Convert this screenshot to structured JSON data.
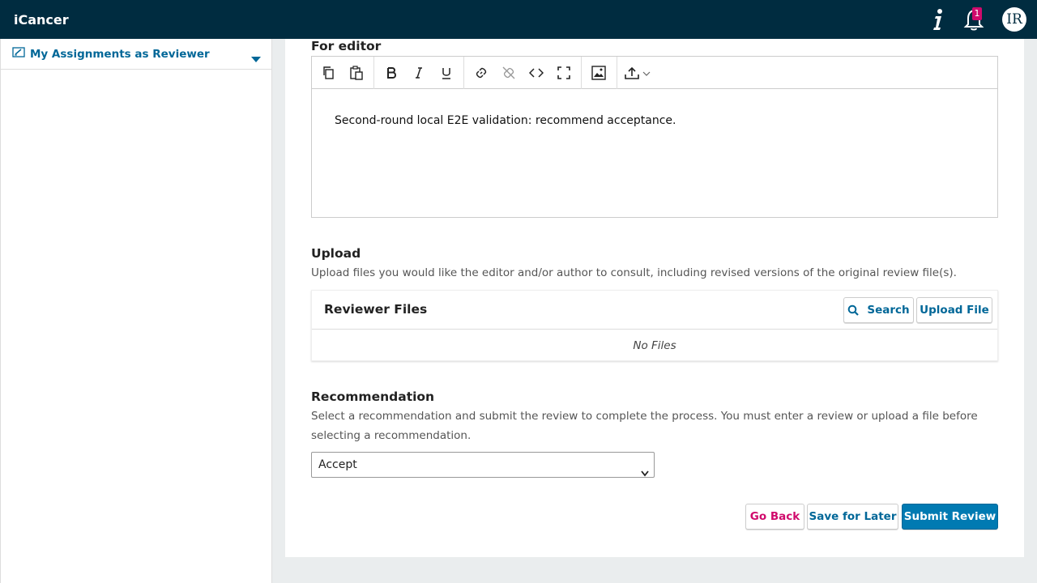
{
  "app": {
    "title": "iCancer"
  },
  "header": {
    "notification_count": "1",
    "avatar_initials": "IR"
  },
  "sidebar": {
    "items": [
      {
        "label": "My Assignments as Reviewer"
      }
    ]
  },
  "review": {
    "for_editor_label": "For editor",
    "editor_text": "Second-round local E2E validation: recommend acceptance.",
    "upload_label": "Upload",
    "upload_desc": "Upload files you would like the editor and/or author to consult, including revised versions of the original review file(s).",
    "files_title": "Reviewer Files",
    "search_label": "Search",
    "upload_file_label": "Upload File",
    "no_files": "No Files",
    "recommendation_label": "Recommendation",
    "recommendation_desc": "Select a recommendation and submit the review to complete the process. You must enter a review or upload a file before selecting a recommendation.",
    "recommendation_value": "Accept",
    "go_back": "Go Back",
    "save_later": "Save for Later",
    "submit": "Submit Review"
  },
  "colors": {
    "topbar": "#002c40",
    "link": "#006798",
    "primary": "#007ab2",
    "danger": "#d00a6c"
  }
}
